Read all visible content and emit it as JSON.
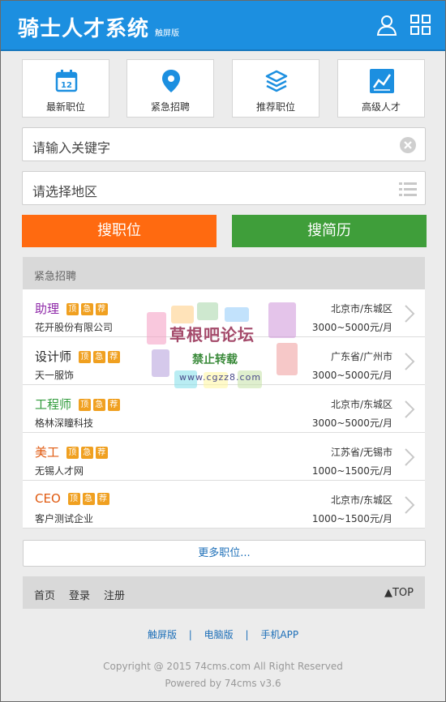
{
  "header": {
    "logo": "骑士人才系统",
    "logo_tag": "触屏版",
    "bg_color": "#1c8fe0"
  },
  "quick_nav": [
    {
      "label": "最新职位",
      "icon": "calendar-icon"
    },
    {
      "label": "紧急招聘",
      "icon": "location-pin-icon"
    },
    {
      "label": "推荐职位",
      "icon": "layers-icon"
    },
    {
      "label": "高级人才",
      "icon": "trend-chart-icon"
    }
  ],
  "search": {
    "keyword_placeholder": "请输入关键字",
    "region_placeholder": "请选择地区",
    "search_jobs_label": "搜职位",
    "search_resumes_label": "搜简历",
    "search_jobs_color": "#ff6a10",
    "search_resumes_color": "#3f9e3a"
  },
  "urgent": {
    "heading": "紧急招聘",
    "tags": [
      "顶",
      "急",
      "荐"
    ],
    "jobs": [
      {
        "title": "助理",
        "title_color": "#8e28a8",
        "company": "花开股份有限公司",
        "location": "北京市/东城区",
        "salary": "3000~5000元/月"
      },
      {
        "title": "设计师",
        "title_color": "#222222",
        "company": "天一服饰",
        "location": "广东省/广州市",
        "salary": "3000~5000元/月"
      },
      {
        "title": "工程师",
        "title_color": "#2f9a3a",
        "company": "格林深瞳科技",
        "location": "北京市/东城区",
        "salary": "3000~5000元/月"
      },
      {
        "title": "美工",
        "title_color": "#e05a10",
        "company": "无锡人才网",
        "location": "江苏省/无锡市",
        "salary": "1000~1500元/月"
      },
      {
        "title": "CEO",
        "title_color": "#e05a10",
        "company": "客户测试企业",
        "location": "北京市/东城区",
        "salary": "1000~1500元/月"
      }
    ],
    "more_label": "更多职位..."
  },
  "watermark": {
    "line1": "草根吧论坛",
    "line2": "禁止转载",
    "line3": "www.cgzz8.com"
  },
  "footer": {
    "nav": [
      "首页",
      "登录",
      "注册"
    ],
    "top_label": "▲TOP",
    "links": [
      "触屏版",
      "电脑版",
      "手机APP"
    ],
    "link_sep": "|",
    "copyright": "Copyright @ 2015 74cms.com All Right Reserved",
    "powered": "Powered by 74cms v3.6"
  }
}
